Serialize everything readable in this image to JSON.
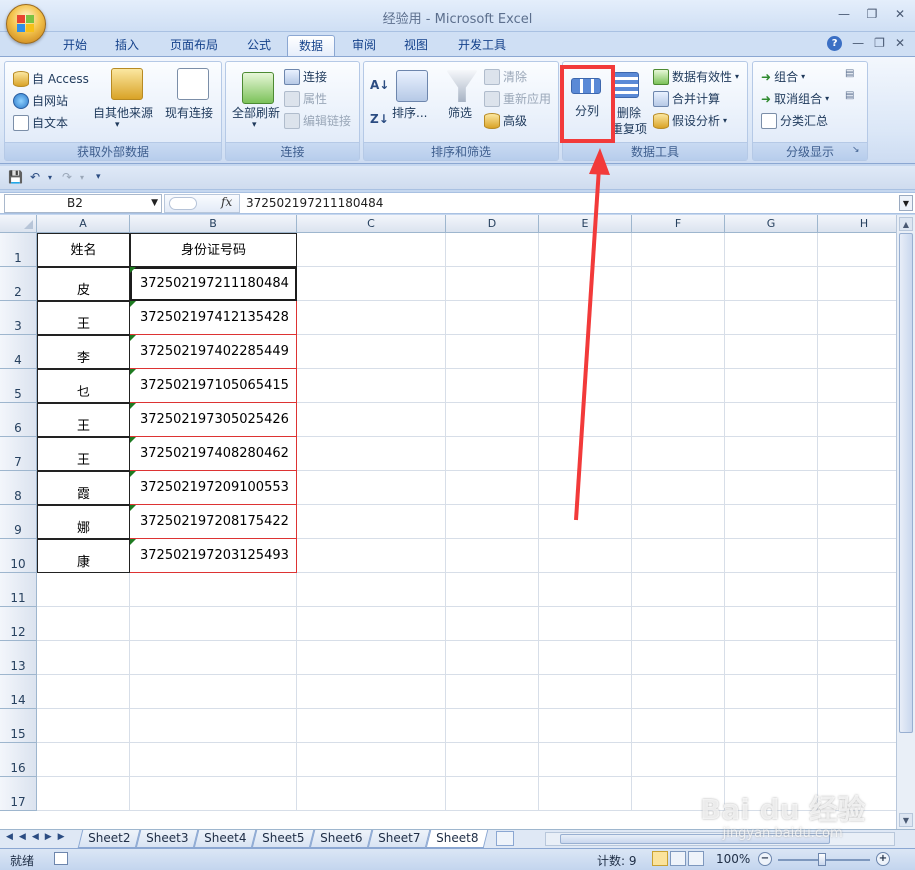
{
  "window": {
    "title": "经验用 - Microsoft Excel"
  },
  "tabs": [
    "开始",
    "插入",
    "页面布局",
    "公式",
    "数据",
    "审阅",
    "视图",
    "开发工具"
  ],
  "active_tab": "数据",
  "ribbon": {
    "external": {
      "label": "获取外部数据",
      "access": "自 Access",
      "web": "自网站",
      "text": "自文本",
      "other": "自其他来源",
      "existing": "现有连接"
    },
    "connections": {
      "label": "连接",
      "refresh_all": "全部刷新",
      "connections": "连接",
      "properties": "属性",
      "edit_links": "编辑链接"
    },
    "sort_filter": {
      "label": "排序和筛选",
      "sort": "排序...",
      "filter": "筛选",
      "clear": "清除",
      "reapply": "重新应用",
      "advanced": "高级"
    },
    "data_tools": {
      "label": "数据工具",
      "text_to_columns": "分列",
      "remove_dup_1": "删除",
      "remove_dup_2": "重复项",
      "validation": "数据有效性",
      "consolidate": "合并计算",
      "whatif": "假设分析"
    },
    "outline": {
      "label": "分级显示",
      "group": "组合",
      "ungroup": "取消组合",
      "subtotal": "分类汇总"
    }
  },
  "formula_bar": {
    "name_box": "B2",
    "fx": "fx",
    "value": "372502197211180484"
  },
  "columns": [
    "A",
    "B",
    "C",
    "D",
    "E",
    "F",
    "G",
    "H"
  ],
  "rows": [
    "1",
    "2",
    "3",
    "4",
    "5",
    "6",
    "7",
    "8",
    "9",
    "10",
    "11",
    "12",
    "13",
    "14",
    "15",
    "16",
    "17"
  ],
  "table": {
    "headers": [
      "姓名",
      "身份证号码"
    ],
    "rows": [
      [
        "皮",
        "372502197211180484"
      ],
      [
        "王",
        "372502197412135428"
      ],
      [
        "李",
        "372502197402285449"
      ],
      [
        "乜",
        "372502197105065415"
      ],
      [
        "王",
        "372502197305025426"
      ],
      [
        "王",
        "372502197408280462"
      ],
      [
        "霞",
        "372502197209100553"
      ],
      [
        "娜",
        "372502197208175422"
      ],
      [
        "康",
        "372502197203125493"
      ]
    ]
  },
  "sheets": [
    "Sheet2",
    "Sheet3",
    "Sheet4",
    "Sheet5",
    "Sheet6",
    "Sheet7",
    "Sheet8"
  ],
  "active_sheet": "Sheet8",
  "status": {
    "ready": "就绪",
    "count": "计数: 9",
    "zoom": "100%"
  },
  "watermark": {
    "main": "Bai du 经验",
    "sub": "jingyan.baidu.com"
  },
  "colors": {
    "annotation": "#f23a3a",
    "ribbon_text": "#1e395b"
  }
}
